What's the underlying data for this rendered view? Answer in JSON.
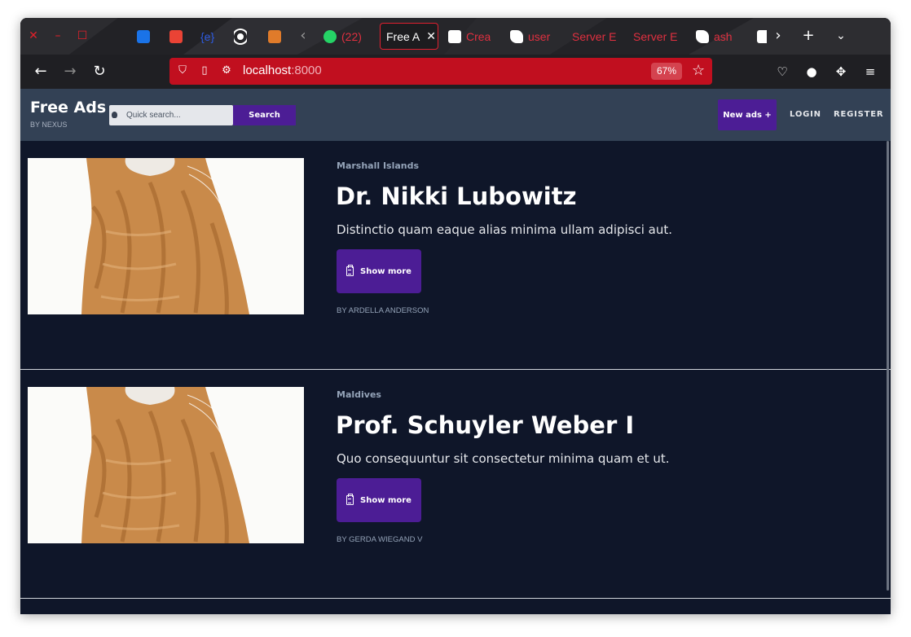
{
  "browser": {
    "tabs": [
      {
        "label": "",
        "icon": "outlook-icon",
        "color": "#1a73e8"
      },
      {
        "label": "",
        "icon": "gmail-icon",
        "color": "#ea4335"
      },
      {
        "label": "{e}",
        "icon": "code-icon",
        "color": "#2d5be3"
      },
      {
        "label": "",
        "icon": "circle-app-icon",
        "color": "#ffffff"
      },
      {
        "label": "",
        "icon": "bug-app-icon",
        "color": "#e07b2a"
      },
      {
        "label": "(22)",
        "icon": "whatsapp-icon",
        "color": "#25d366"
      },
      {
        "label": "Free A",
        "icon": "",
        "color": "#ffffff"
      },
      {
        "label": "Crea",
        "icon": "medium-icon",
        "color": "#ffffff"
      },
      {
        "label": "user",
        "icon": "server-icon",
        "color": "#ffffff"
      },
      {
        "label": "Server E",
        "icon": "",
        "color": "#e03040"
      },
      {
        "label": "Server E",
        "icon": "",
        "color": "#e03040"
      },
      {
        "label": "ash",
        "icon": "server-icon",
        "color": "#ffffff"
      },
      {
        "label": "",
        "icon": "server-icon",
        "color": "#ffffff"
      }
    ],
    "url_host": "localhost",
    "url_port": ":8000",
    "zoom": "67%"
  },
  "site": {
    "brand": "Free Ads",
    "brand_sub": "BY NEXUS",
    "search_placeholder": "Quick search...",
    "search_button": "Search",
    "new_ads": "New ads +",
    "login": "LOGIN",
    "register": "REGISTER"
  },
  "listings": [
    {
      "location": "Marshall Islands",
      "title": "Dr. Nikki Lubowitz",
      "description": "Distinctio quam eaque alias minima ullam adipisci aut.",
      "button": "Show more",
      "author": "BY ARDELLA ANDERSON"
    },
    {
      "location": "Maldives",
      "title": "Prof. Schuyler Weber I",
      "description": "Quo consequuntur sit consectetur minima quam et ut.",
      "button": "Show more",
      "author": "BY GERDA WIEGAND V"
    }
  ]
}
